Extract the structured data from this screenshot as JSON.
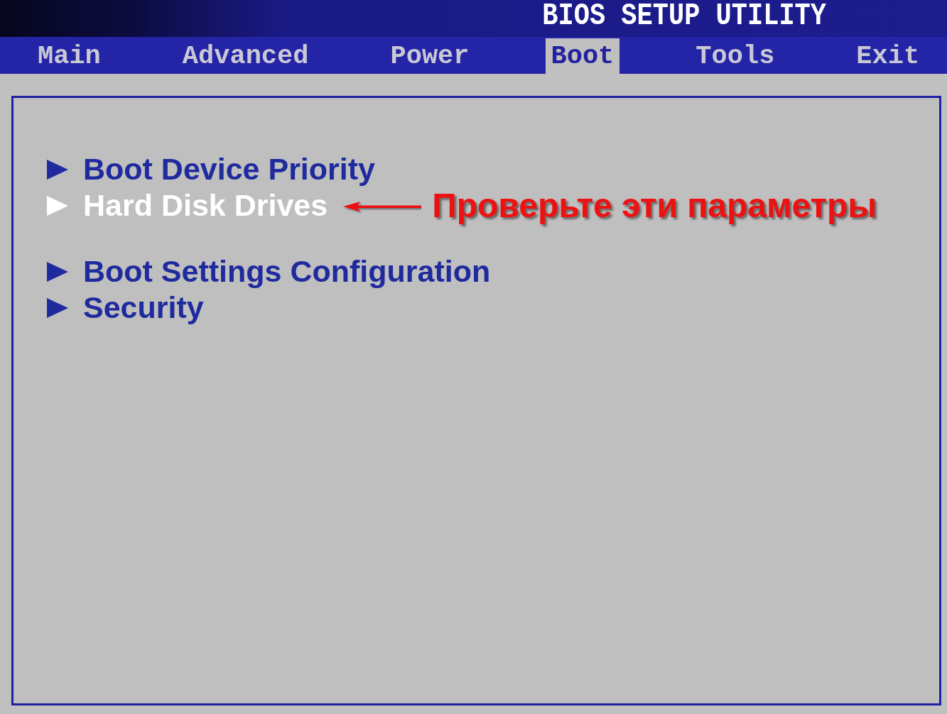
{
  "title": "BIOS SETUP UTILITY",
  "tabs": [
    {
      "label": "Main",
      "selected": false
    },
    {
      "label": "Advanced",
      "selected": false
    },
    {
      "label": "Power",
      "selected": false
    },
    {
      "label": "Boot",
      "selected": true
    },
    {
      "label": "Tools",
      "selected": false
    },
    {
      "label": "Exit",
      "selected": false
    }
  ],
  "menu_groups": [
    {
      "items": [
        {
          "label": "Boot Device Priority",
          "selected": false
        },
        {
          "label": "Hard Disk Drives",
          "selected": true,
          "annotation": "Проверьте эти параметры"
        }
      ]
    },
    {
      "items": [
        {
          "label": "Boot Settings Configuration",
          "selected": false
        },
        {
          "label": "Security",
          "selected": false
        }
      ]
    }
  ]
}
